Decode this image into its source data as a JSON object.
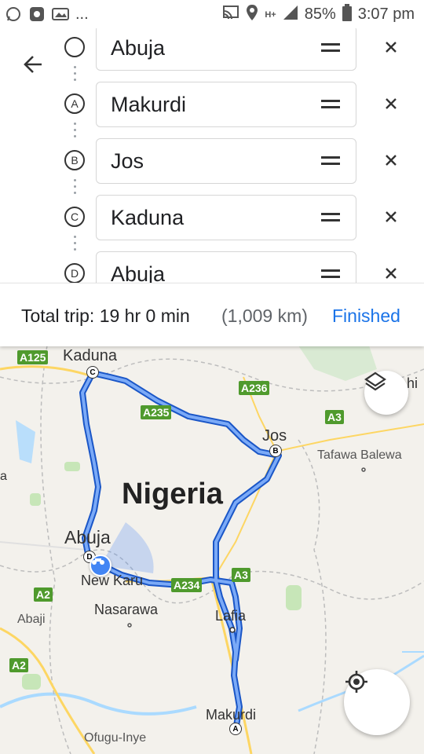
{
  "status_bar": {
    "left_icons": [
      "whatsapp-icon",
      "app-icon",
      "photo-icon"
    ],
    "more": "...",
    "right_icons": [
      "cast-icon",
      "location-icon",
      "hplus-icon",
      "signal-icon"
    ],
    "battery": "85%",
    "time": "3:07 pm"
  },
  "directions": {
    "stops": [
      {
        "marker": "",
        "value": "Abuja"
      },
      {
        "marker": "A",
        "value": "Makurdi"
      },
      {
        "marker": "B",
        "value": "Jos"
      },
      {
        "marker": "C",
        "value": "Kaduna"
      },
      {
        "marker": "D",
        "value": "Abuja"
      }
    ]
  },
  "trip": {
    "total": "Total trip: 19 hr 0 min",
    "distance": "(1,009 km)",
    "finished": "Finished"
  },
  "map": {
    "country": "Nigeria",
    "cities": {
      "kaduna": "Kaduna",
      "jos": "Jos",
      "abuja": "Abuja",
      "new_karu": "New Karu",
      "nasarawa": "Nasarawa",
      "lafia": "Lafia",
      "makurdi": "Makurdi",
      "abaji": "Abaji",
      "tafawa_balewa": "Tafawa Balewa",
      "ofugu_inye": "Ofugu-Inye",
      "edge_right": "hi",
      "edge_left": "a"
    },
    "roads": [
      "A125",
      "A236",
      "A235",
      "A3",
      "A234",
      "A3",
      "A2",
      "A2"
    ],
    "markers": {
      "a": "A",
      "b": "B",
      "c": "C",
      "d": "D"
    },
    "route_color": "#4285f4"
  }
}
